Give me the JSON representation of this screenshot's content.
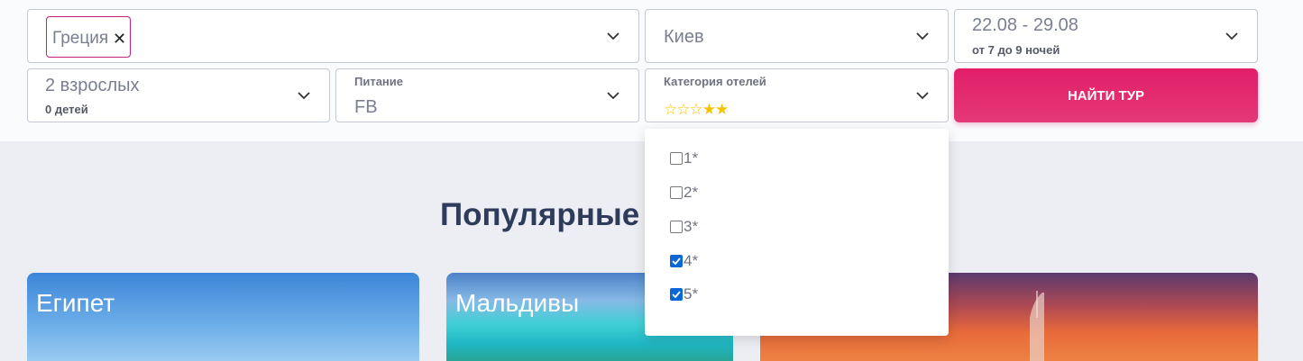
{
  "search": {
    "destination": {
      "tag": "Греция",
      "remove_icon": "close-icon"
    },
    "departure": {
      "value": "Киев"
    },
    "dates": {
      "range": "22.08 - 29.08",
      "nights": "от 7 до 9 ночей"
    },
    "guests": {
      "adults": "2 взрослых",
      "children": "0 детей"
    },
    "meal": {
      "label": "Питание",
      "value": "FB"
    },
    "hotel_category": {
      "label": "Категория отелей",
      "stars": "☆☆☆★★"
    },
    "submit_label": "НАЙТИ ТУР",
    "chevron_icon": "chevron-down-icon"
  },
  "category_dropdown": {
    "options": [
      {
        "label": "1*",
        "checked": false
      },
      {
        "label": "2*",
        "checked": false
      },
      {
        "label": "3*",
        "checked": false
      },
      {
        "label": "4*",
        "checked": true
      },
      {
        "label": "5*",
        "checked": true
      }
    ]
  },
  "popular": {
    "heading": "Популярные",
    "cards": [
      {
        "title": "Египет"
      },
      {
        "title": "Мальдивы"
      },
      {
        "title": ""
      }
    ]
  },
  "colors": {
    "accent": "#e21f68",
    "tag_border": "#c6207a",
    "checkbox_on": "#0b67d6",
    "star": "#f5c400",
    "heading": "#2e3b5a"
  }
}
